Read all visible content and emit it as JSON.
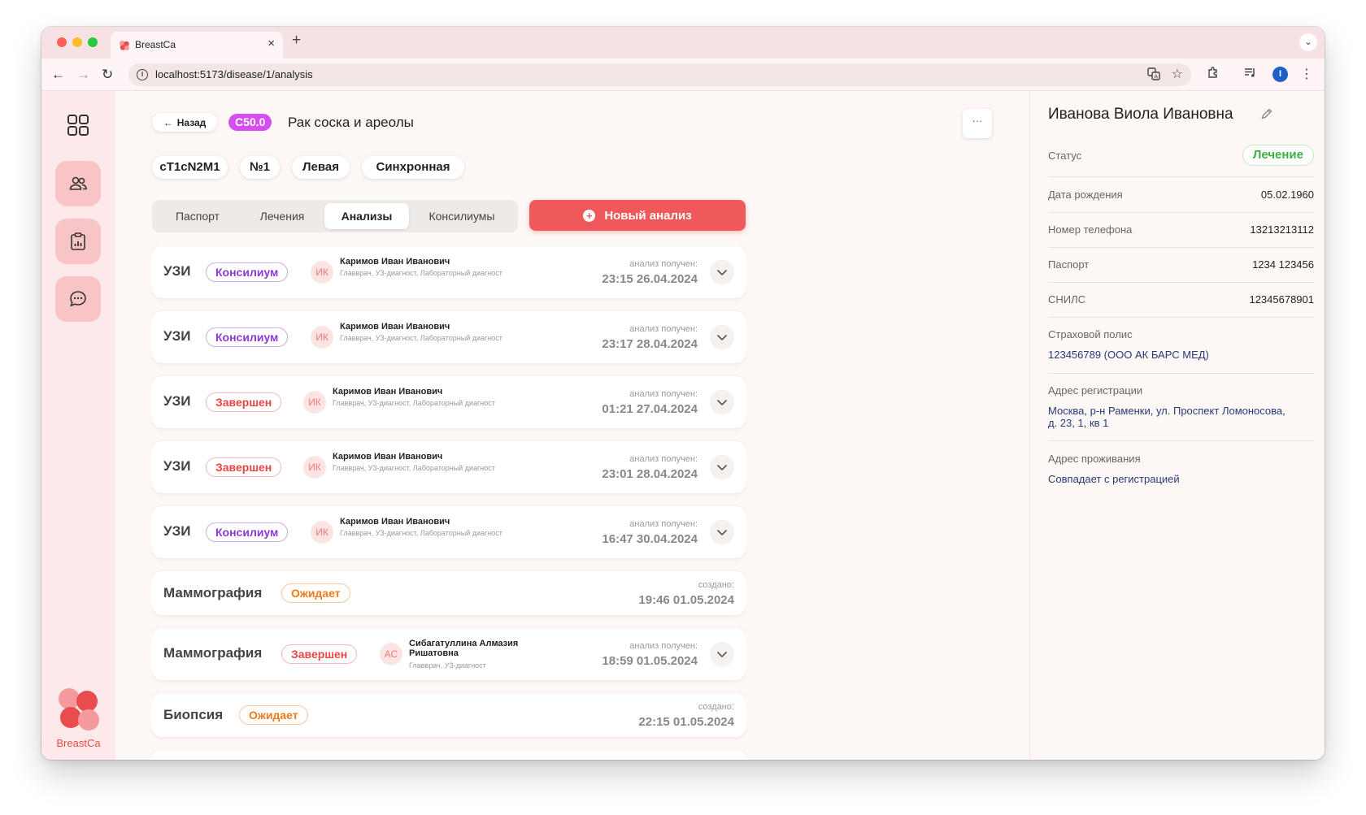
{
  "browser": {
    "tab_title": "BreastCa",
    "url": "localhost:5173/disease/1/analysis",
    "profile_initial": "I"
  },
  "sidebar": {
    "brand": "BreastCa"
  },
  "header": {
    "back_label": "Назад",
    "icd_code": "C50.0",
    "title": "Рак соска и ареолы",
    "more_label": "···"
  },
  "chips": [
    "cT1cN2M1",
    "№1",
    "Левая",
    "Синхронная"
  ],
  "tabs": [
    {
      "label": "Паспорт",
      "active": false
    },
    {
      "label": "Лечения",
      "active": false
    },
    {
      "label": "Анализы",
      "active": true
    },
    {
      "label": "Консилиумы",
      "active": false
    }
  ],
  "new_analysis_label": "Новый анализ",
  "analyses": [
    {
      "type": "УЗИ",
      "status": "Консилиум",
      "avatar": "ИК",
      "doctor": "Каримов Иван Иванович",
      "role": "Главврач, УЗ-диагност, Лабораторный диагност",
      "date_label": "анализ получен:",
      "date": "23:15 26.04.2024"
    },
    {
      "type": "УЗИ",
      "status": "Консилиум",
      "avatar": "ИК",
      "doctor": "Каримов Иван Иванович",
      "role": "Главврач, УЗ-диагност, Лабораторный диагност",
      "date_label": "анализ получен:",
      "date": "23:17 28.04.2024"
    },
    {
      "type": "УЗИ",
      "status": "Завершен",
      "avatar": "ИК",
      "doctor": "Каримов Иван Иванович",
      "role": "Главврач, УЗ-диагност, Лабораторный диагност",
      "date_label": "анализ получен:",
      "date": "01:21 27.04.2024"
    },
    {
      "type": "УЗИ",
      "status": "Завершен",
      "avatar": "ИК",
      "doctor": "Каримов Иван Иванович",
      "role": "Главврач, УЗ-диагност, Лабораторный диагност",
      "date_label": "анализ получен:",
      "date": "23:01 28.04.2024"
    },
    {
      "type": "УЗИ",
      "status": "Консилиум",
      "avatar": "ИК",
      "doctor": "Каримов Иван Иванович",
      "role": "Главврач, УЗ-диагност, Лабораторный диагност",
      "date_label": "анализ получен:",
      "date": "16:47 30.04.2024"
    },
    {
      "type": "Маммография",
      "status": "Ожидает",
      "date_label": "создано:",
      "date": "19:46 01.05.2024"
    },
    {
      "type": "Маммография",
      "status": "Завершен",
      "avatar": "АС",
      "doctor": "Сибагатуллина Алмазия Ришатовна",
      "role": "Главврач, УЗ-диагност",
      "date_label": "анализ получен:",
      "date": "18:59 01.05.2024"
    },
    {
      "type": "Биопсия",
      "status": "Ожидает",
      "date_label": "создано:",
      "date": "22:15 01.05.2024"
    }
  ],
  "patient": {
    "name": "Иванова Виола Ивановна",
    "status_label": "Статус",
    "status": "Лечение",
    "fields": [
      {
        "label": "Дата рождения",
        "value": "05.02.1960"
      },
      {
        "label": "Номер телефона",
        "value": "13213213112"
      },
      {
        "label": "Паспорт",
        "value": "1234 123456"
      },
      {
        "label": "СНИЛС",
        "value": "12345678901"
      }
    ],
    "insurance_label": "Страховой полис",
    "insurance": "123456789 (ООО АК БАРС МЕД)",
    "reg_label": "Адрес регистрации",
    "reg_line1": "Москва, р-н Раменки, ул. Проспект Ломоносова,",
    "reg_line2": "д. 23, 1, кв 1",
    "live_label": "Адрес проживания",
    "live": "Совпадает с регистрацией"
  },
  "colors": {
    "accent": "#f0595c",
    "sidebar_bg": "#fde9e9",
    "sidebar_item": "#f9c4c6",
    "icd_badge": "#d64df0",
    "status_green": "#3cb043",
    "badge_konsilium": "#8a3bd6",
    "badge_done": "#ea4545",
    "badge_wait": "#f07a1a"
  }
}
